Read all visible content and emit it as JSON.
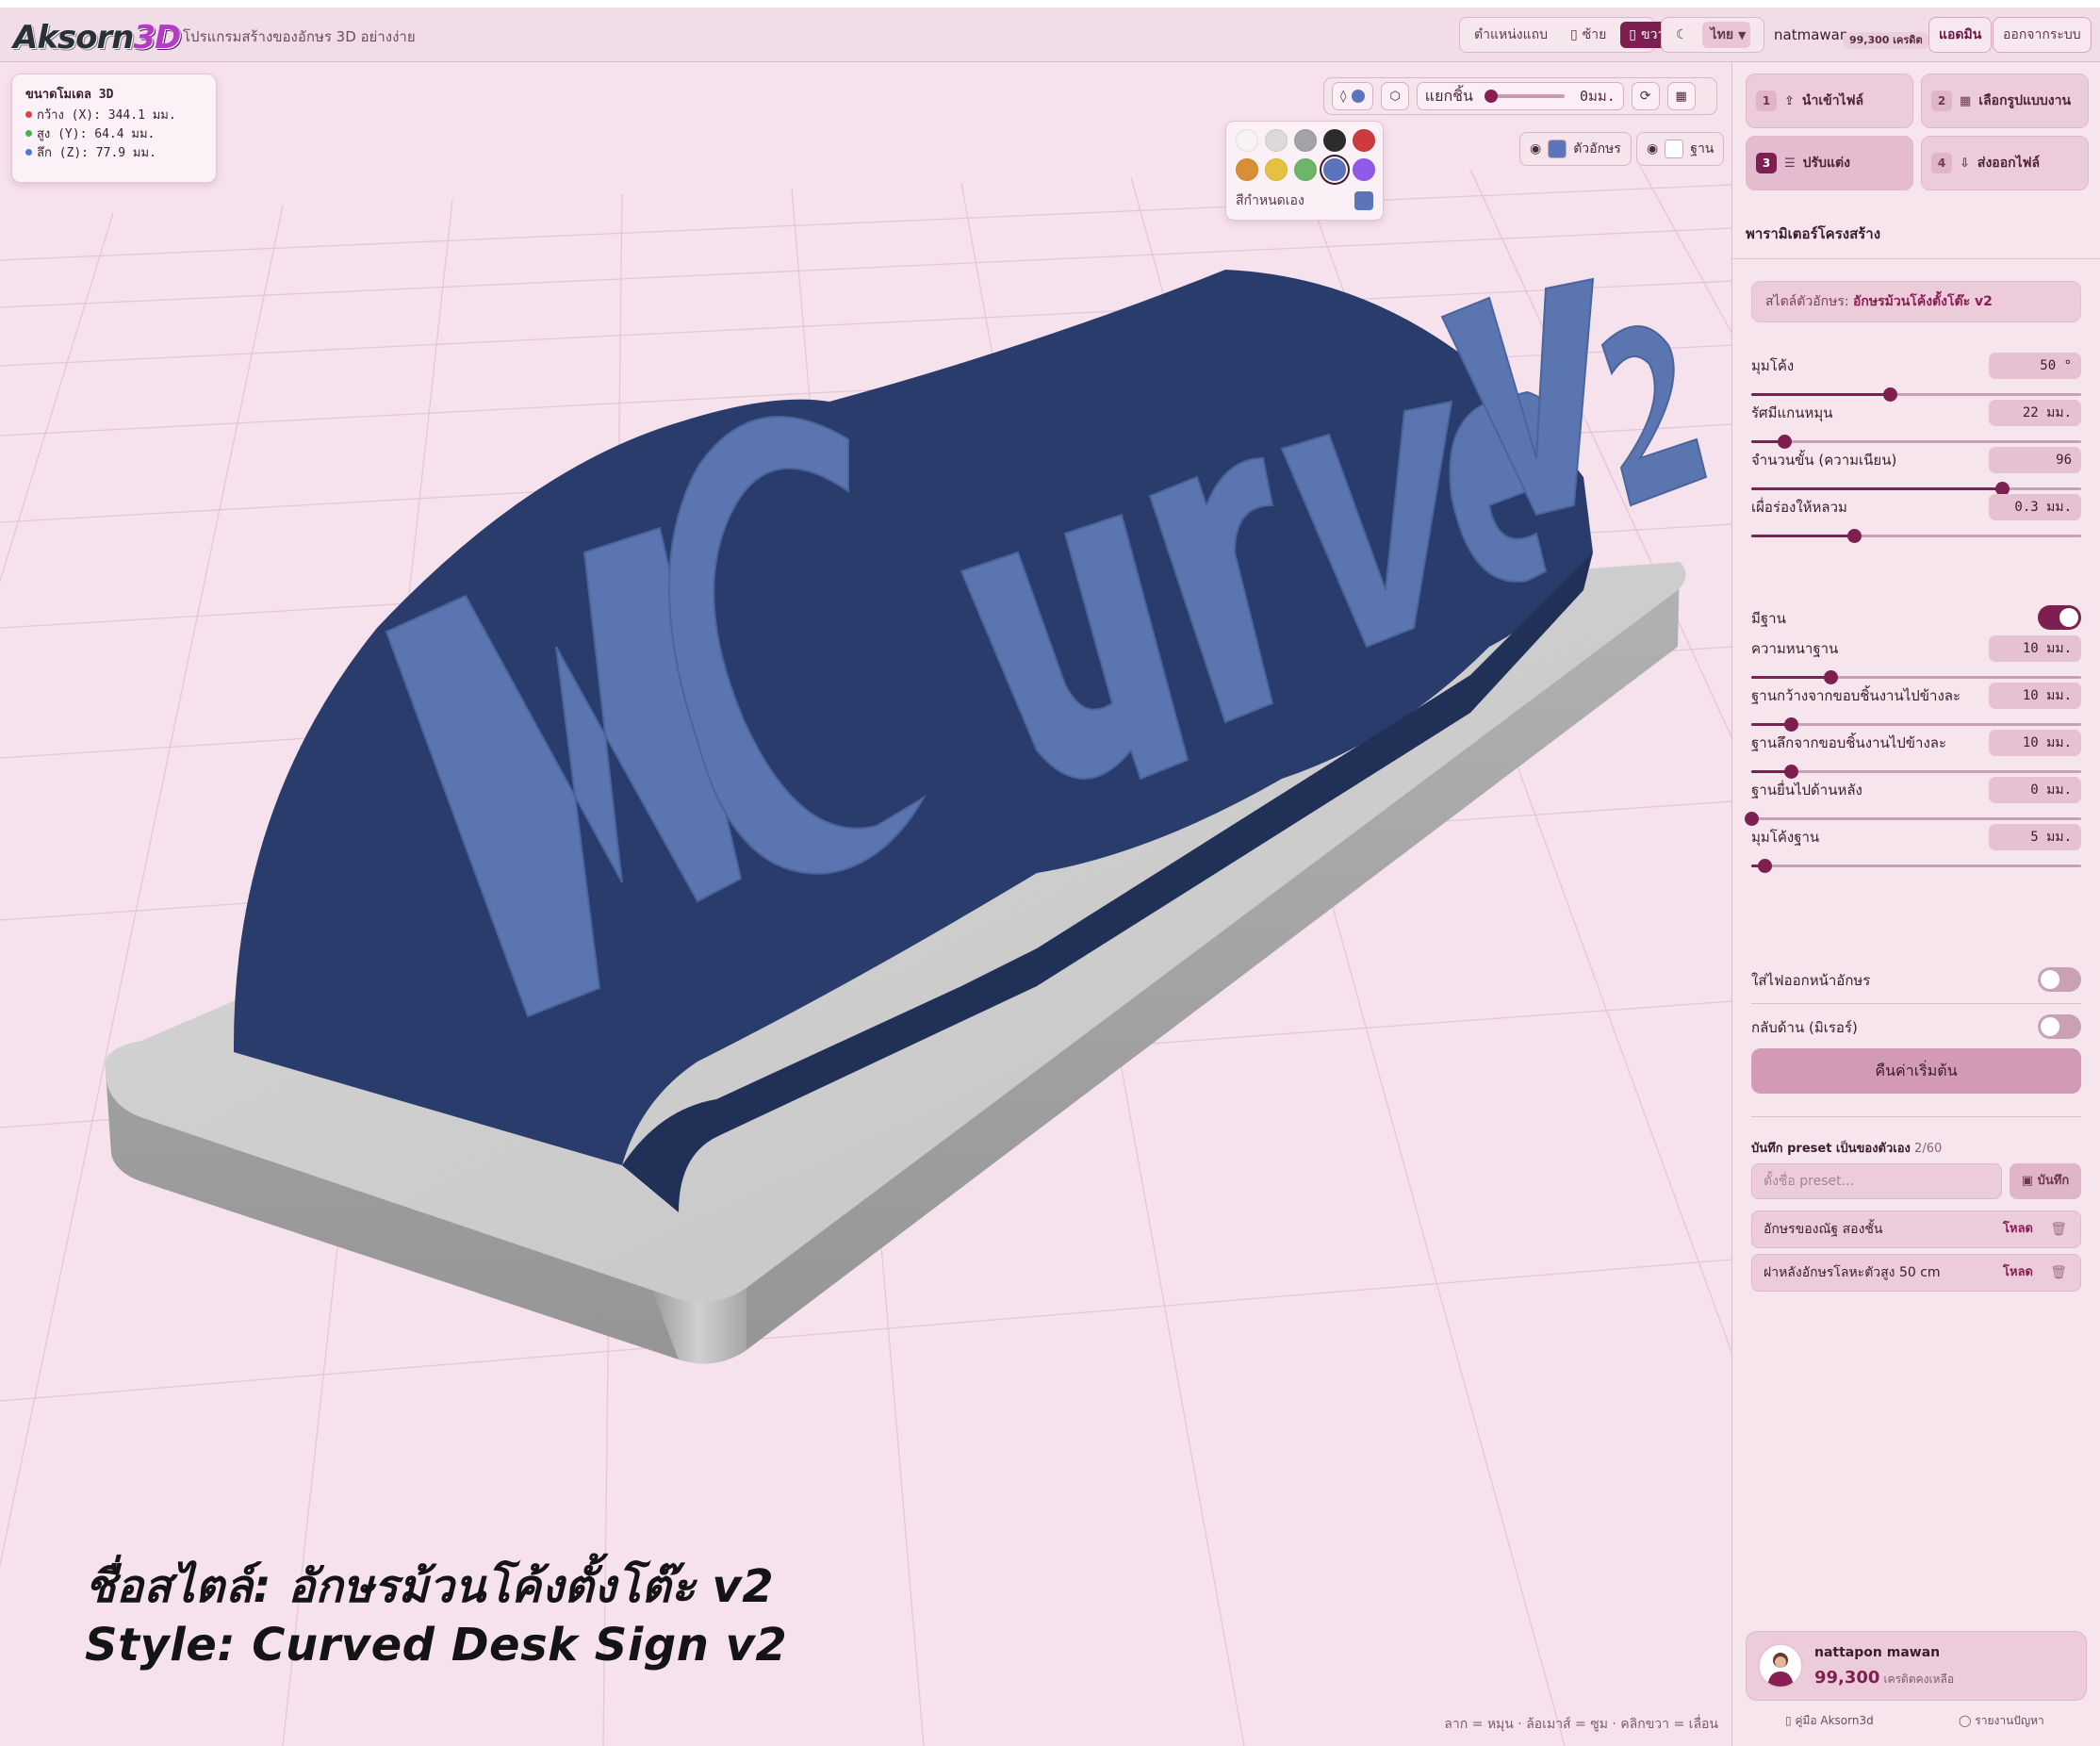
{
  "header": {
    "logo_main": "Aksorn",
    "logo_accent": "3D",
    "tagline": "โปรแกรมสร้างของอักษร 3D อย่างง่าย",
    "layout_label": "ตำแหน่งแถบ",
    "layout_left": "ซ้าย",
    "layout_right": "ขวา",
    "theme_icon": "moon-icon",
    "language": "ไทย",
    "username": "natmawan",
    "credit_badge": "99,300 เครดิต",
    "admin_button": "แอดมิน",
    "logout_button": "ออกจากระบบ"
  },
  "viewport": {
    "dims": {
      "title": "ขนาดโมเดล 3D",
      "width": "กว้าง (X): 344.1 มม.",
      "height": "สูง (Y): 64.4 มม.",
      "depth": "ลึก (Z): 77.9 มม.",
      "colors": {
        "x": "#e0413e",
        "y": "#47b44c",
        "z": "#4a78e0"
      }
    },
    "toolbar": {
      "split_label": "แยกชิ้น",
      "split_value": "0มม.",
      "split_fraction": 0,
      "refresh_icon": "refresh-icon",
      "grid_icon": "grid-icon",
      "color_icon": "droplet-icon",
      "material_icon": "cube-icon",
      "current_color": "#5b74bb"
    },
    "palette": {
      "swatches": [
        "#f6f2f5",
        "#dcd9dc",
        "#a3a2a7",
        "#2c2b2e",
        "#cd3b3b",
        "#d98f35",
        "#e5c13f",
        "#6cb569",
        "#5b74bb",
        "#8f5be8"
      ],
      "selected_index": 8,
      "custom_label": "สีกำหนดเอง",
      "custom_color": "#5b74bb"
    },
    "visibility": {
      "letters_label": "ตัวอักษร",
      "letters_color": "#5b74bb",
      "base_label": "ฐาน",
      "base_color": "#ffffff"
    },
    "model_text": "NCurve V2",
    "caption_th": "ชื่อสไตล์: อักษรม้วนโค้งตั้งโต๊ะ v2",
    "caption_en": "Style: Curved Desk Sign v2",
    "controls_hint": "ลาก = หมุน · ล้อเมาส์ = ซูม · คลิกขวา = เลื่อน"
  },
  "panel": {
    "steps": [
      {
        "num": "1",
        "label": "นำเข้าไฟล์",
        "icon": "upload-icon",
        "active": false
      },
      {
        "num": "2",
        "label": "เลือกรูปแบบงาน",
        "icon": "layout-icon",
        "active": false
      },
      {
        "num": "3",
        "label": "ปรับแต่ง",
        "icon": "sliders-icon",
        "active": true
      },
      {
        "num": "4",
        "label": "ส่งออกไฟล์",
        "icon": "download-icon",
        "active": false
      }
    ],
    "section_title": "พารามิเตอร์โครงสร้าง",
    "style_prefix": "สไตล์ตัวอักษร:",
    "style_name": "อักษรม้วนโค้งตั้งโต๊ะ v2",
    "params": [
      {
        "label": "มุมโค้ง",
        "value": "50 °",
        "fraction": 0.42
      },
      {
        "label": "รัศมีแกนหมุน",
        "value": "22 มม.",
        "fraction": 0.1
      },
      {
        "label": "จำนวนขั้น (ความเนียน)",
        "value": "96",
        "fraction": 0.76
      },
      {
        "label": "เผื่อร่องให้หลวม",
        "value": "0.3 มม.",
        "fraction": 0.31
      }
    ],
    "has_base": {
      "label": "มีฐาน",
      "on": true
    },
    "base_params": [
      {
        "label": "ความหนาฐาน",
        "value": "10 มม.",
        "fraction": 0.24
      },
      {
        "label": "ฐานกว้างจากขอบชิ้นงานไปข้างละ",
        "value": "10 มม.",
        "fraction": 0.12
      },
      {
        "label": "ฐานลึกจากขอบชิ้นงานไปข้างละ",
        "value": "10 มม.",
        "fraction": 0.12
      },
      {
        "label": "ฐานยื่นไปด้านหลัง",
        "value": "0 มม.",
        "fraction": 0.0
      },
      {
        "label": "มุมโค้งฐาน",
        "value": "5 มม.",
        "fraction": 0.04
      }
    ],
    "front_light": {
      "label": "ใส่ไฟออกหน้าอักษร",
      "on": false
    },
    "mirror": {
      "label": "กลับด้าน (มิเรอร์)",
      "on": false
    },
    "reset_button": "คืนค่าเริ่มต้น",
    "preset": {
      "title": "บันทึก preset เป็นของตัวเอง",
      "count": "2/60",
      "placeholder": "ตั้งชื่อ preset...",
      "save_label": "บันทึก",
      "items": [
        {
          "name": "อักษรของณัฐ สองชั้น",
          "load": "โหลด"
        },
        {
          "name": "ฝาหลังอักษรโลหะตัวสูง 50 cm",
          "load": "โหลด"
        }
      ]
    },
    "account": {
      "name": "nattapon mawan",
      "credits": "99,300",
      "credits_suffix": "เครดิตคงเหลือ"
    },
    "footer": {
      "guide": "คู่มือ Aksorn3d",
      "report": "รายงานปัญหา"
    }
  }
}
